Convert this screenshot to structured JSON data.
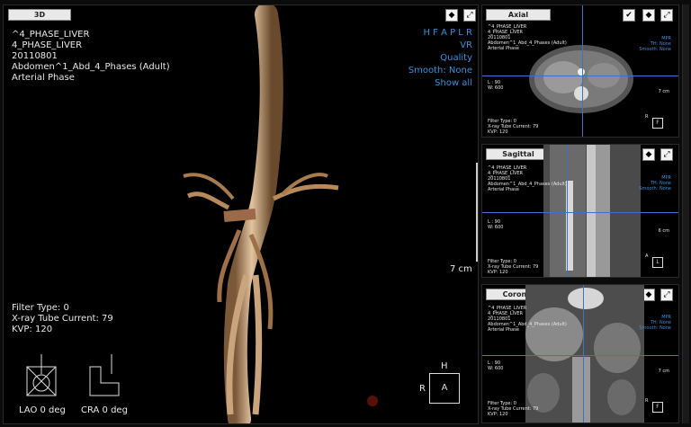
{
  "main_view": {
    "tab_label": "3D",
    "patient": [
      "^4_PHASE_LIVER",
      "4_PHASE_LIVER",
      "20110801",
      "Abdomen^1_Abd_4_Phases (Adult)",
      "Arterial Phase"
    ],
    "menu": [
      "H F A P L R",
      "VR",
      "Quality",
      "Smooth: None",
      "Show all"
    ],
    "scale": "7 cm",
    "filter": [
      "Filter Type: 0",
      "X-ray Tube Current: 79",
      "KVP: 120"
    ],
    "orient": {
      "top": "H",
      "left": "R",
      "center": "A"
    },
    "angles": {
      "lao": "LAO 0 deg",
      "cra": "CRA 0 deg"
    }
  },
  "small_views": [
    {
      "tab": "Axial",
      "patient": [
        "^4_PHASE_LIVER",
        "4_PHASE_LIVER",
        "20110801",
        "Abdomen^1_Abd_4_Phases (Adult)",
        "Arterial Phase"
      ],
      "right_info": [
        "MPR",
        "TH: None",
        "Smooth: None"
      ],
      "wl": [
        "L : 90",
        "W: 600"
      ],
      "scale": "7 cm",
      "filter": [
        "Filter Type: 0",
        "X-ray Tube Current: 79",
        "KVP: 120"
      ],
      "orient_top": "R",
      "orient_box": "F"
    },
    {
      "tab": "Sagittal",
      "patient": [
        "^4_PHASE_LIVER",
        "4_PHASE_LIVER",
        "20110801",
        "Abdomen^1_Abd_4_Phases (Adult)",
        "Arterial Phase"
      ],
      "right_info": [
        "MPR",
        "TH: None",
        "Smooth: None"
      ],
      "wl": [
        "L : 90",
        "W: 600"
      ],
      "scale": "6 cm",
      "filter": [
        "Filter Type: 0",
        "X-ray Tube Current: 79",
        "KVP: 120"
      ],
      "orient_top": "A",
      "orient_box": "L"
    },
    {
      "tab": "Coronal",
      "patient": [
        "^4_PHASE_LIVER",
        "4_PHASE_LIVER",
        "20110801",
        "Abdomen^1_Abd_4_Phases (Adult)",
        "Arterial Phase"
      ],
      "right_info": [
        "MPR",
        "TH: None",
        "Smooth: None"
      ],
      "wl": [
        "L : 90",
        "W: 600"
      ],
      "scale": "7 cm",
      "filter": [
        "Filter Type: 0",
        "X-ray Tube Current: 79",
        "KVP: 120"
      ],
      "orient_top": "R",
      "orient_box": "F"
    }
  ],
  "icons": {
    "check": "✔",
    "eye": "◆",
    "expand": "⤢"
  },
  "colors": {
    "accent": "#3a74c9",
    "text_blue": "#3b8fd9",
    "vessel": "#caa27a"
  }
}
